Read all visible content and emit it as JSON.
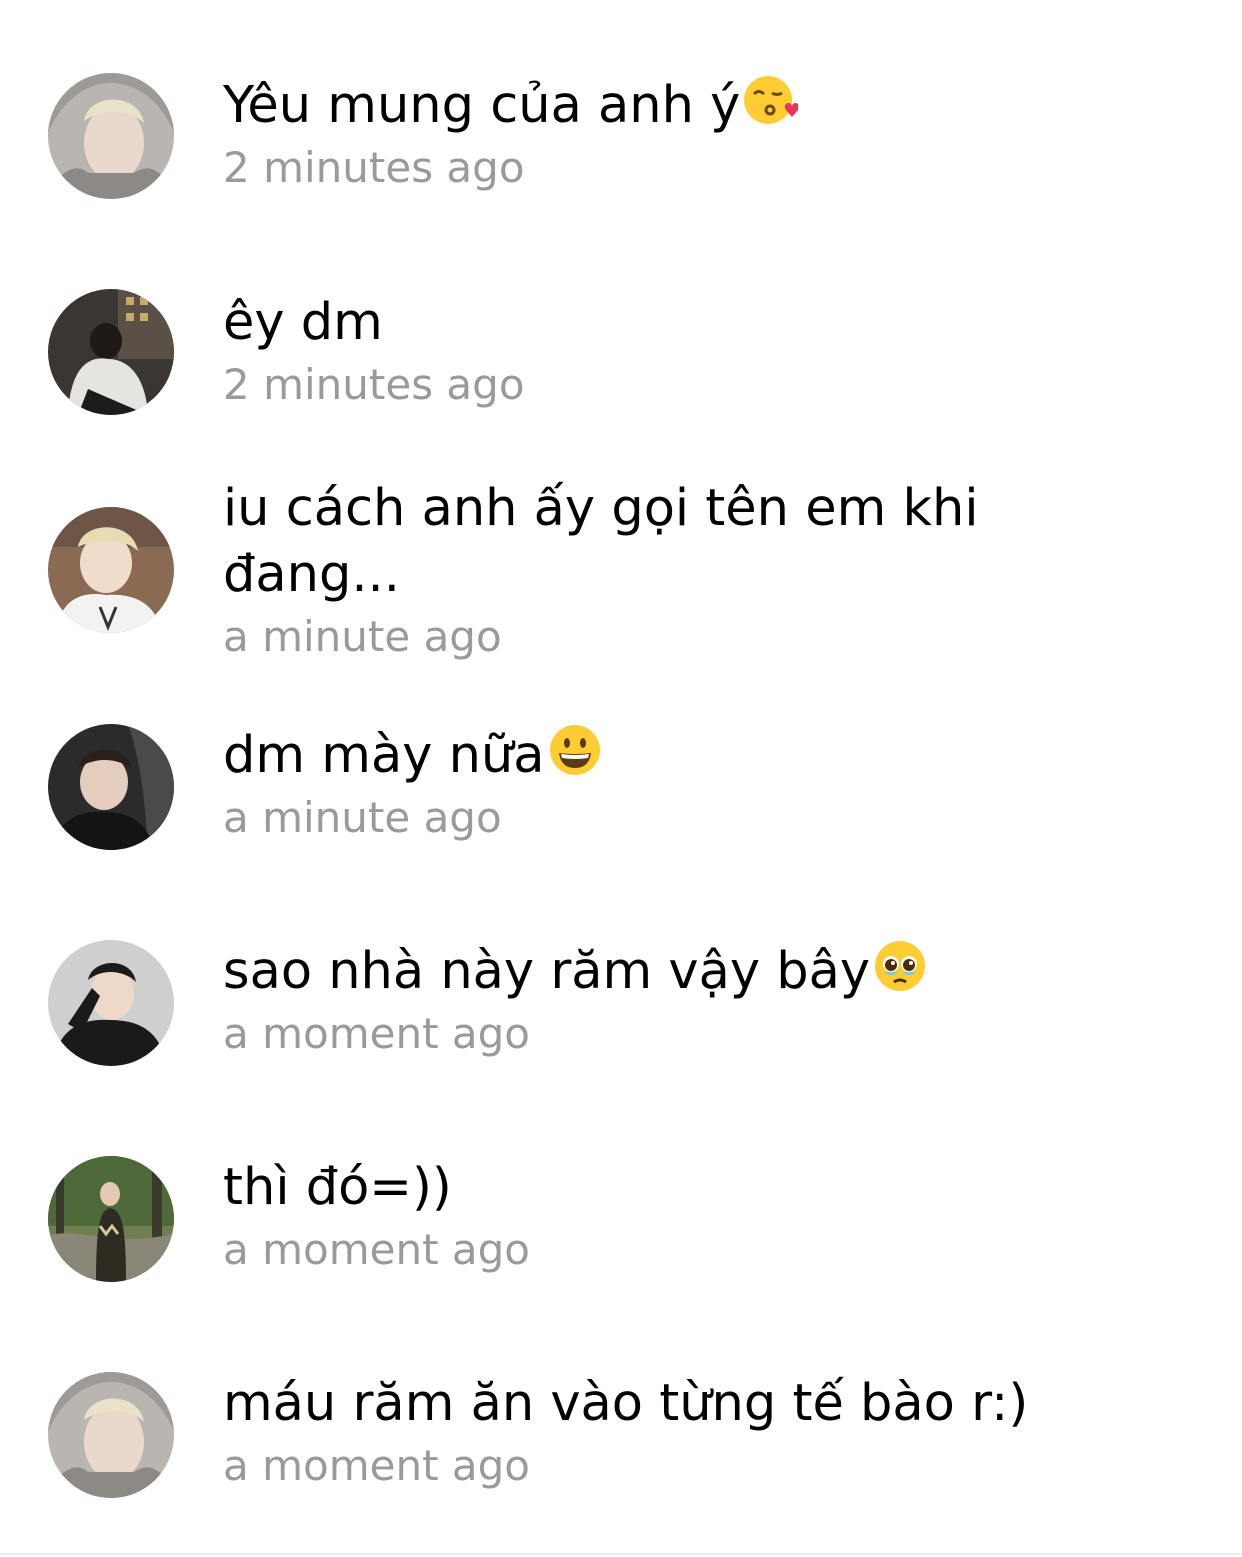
{
  "comments": [
    {
      "text": "Yêu mung của anh ý",
      "emoji": "face-blowing-kiss-emoji",
      "time": "2 minutes ago",
      "avatar": "avatar-grey-hood"
    },
    {
      "text": "êy dm",
      "emoji": "",
      "time": "2 minutes ago",
      "avatar": "avatar-night-city"
    },
    {
      "text": "iu cách anh ấy gọi tên em khi đang...",
      "emoji": "",
      "time": "a minute ago",
      "avatar": "avatar-white-hoodie"
    },
    {
      "text": "dm mày nữa",
      "emoji": "grinning-face-emoji",
      "time": "a minute ago",
      "avatar": "avatar-car-seat"
    },
    {
      "text": "sao nhà này răm vậy bây",
      "emoji": "pleading-face-emoji",
      "time": "a moment ago",
      "avatar": "avatar-black-jacket"
    },
    {
      "text": "thì đó=))",
      "emoji": "",
      "time": "a moment ago",
      "avatar": "avatar-forest"
    },
    {
      "text": "máu răm ăn vào từng tế bào r:)",
      "emoji": "",
      "time": "a moment ago",
      "avatar": "avatar-grey-hood"
    }
  ],
  "colors": {
    "text": "#000000",
    "timestamp": "#9a9a9a",
    "background": "#ffffff"
  }
}
